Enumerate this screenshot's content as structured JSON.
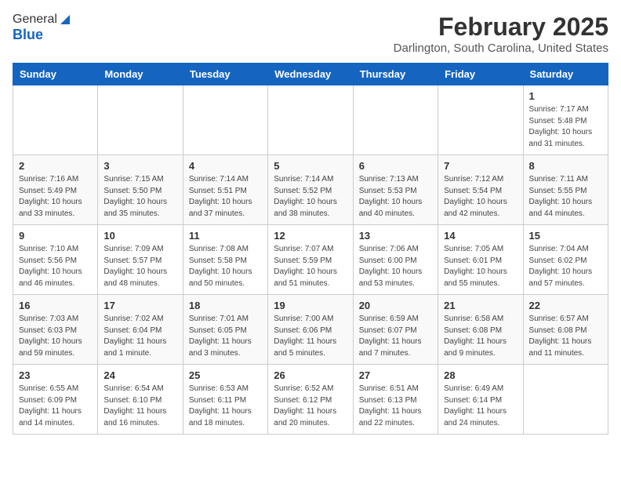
{
  "header": {
    "logo_general": "General",
    "logo_blue": "Blue",
    "title": "February 2025",
    "subtitle": "Darlington, South Carolina, United States"
  },
  "days_of_week": [
    "Sunday",
    "Monday",
    "Tuesday",
    "Wednesday",
    "Thursday",
    "Friday",
    "Saturday"
  ],
  "weeks": [
    [
      {
        "day": "",
        "info": ""
      },
      {
        "day": "",
        "info": ""
      },
      {
        "day": "",
        "info": ""
      },
      {
        "day": "",
        "info": ""
      },
      {
        "day": "",
        "info": ""
      },
      {
        "day": "",
        "info": ""
      },
      {
        "day": "1",
        "info": "Sunrise: 7:17 AM\nSunset: 5:48 PM\nDaylight: 10 hours and 31 minutes."
      }
    ],
    [
      {
        "day": "2",
        "info": "Sunrise: 7:16 AM\nSunset: 5:49 PM\nDaylight: 10 hours and 33 minutes."
      },
      {
        "day": "3",
        "info": "Sunrise: 7:15 AM\nSunset: 5:50 PM\nDaylight: 10 hours and 35 minutes."
      },
      {
        "day": "4",
        "info": "Sunrise: 7:14 AM\nSunset: 5:51 PM\nDaylight: 10 hours and 37 minutes."
      },
      {
        "day": "5",
        "info": "Sunrise: 7:14 AM\nSunset: 5:52 PM\nDaylight: 10 hours and 38 minutes."
      },
      {
        "day": "6",
        "info": "Sunrise: 7:13 AM\nSunset: 5:53 PM\nDaylight: 10 hours and 40 minutes."
      },
      {
        "day": "7",
        "info": "Sunrise: 7:12 AM\nSunset: 5:54 PM\nDaylight: 10 hours and 42 minutes."
      },
      {
        "day": "8",
        "info": "Sunrise: 7:11 AM\nSunset: 5:55 PM\nDaylight: 10 hours and 44 minutes."
      }
    ],
    [
      {
        "day": "9",
        "info": "Sunrise: 7:10 AM\nSunset: 5:56 PM\nDaylight: 10 hours and 46 minutes."
      },
      {
        "day": "10",
        "info": "Sunrise: 7:09 AM\nSunset: 5:57 PM\nDaylight: 10 hours and 48 minutes."
      },
      {
        "day": "11",
        "info": "Sunrise: 7:08 AM\nSunset: 5:58 PM\nDaylight: 10 hours and 50 minutes."
      },
      {
        "day": "12",
        "info": "Sunrise: 7:07 AM\nSunset: 5:59 PM\nDaylight: 10 hours and 51 minutes."
      },
      {
        "day": "13",
        "info": "Sunrise: 7:06 AM\nSunset: 6:00 PM\nDaylight: 10 hours and 53 minutes."
      },
      {
        "day": "14",
        "info": "Sunrise: 7:05 AM\nSunset: 6:01 PM\nDaylight: 10 hours and 55 minutes."
      },
      {
        "day": "15",
        "info": "Sunrise: 7:04 AM\nSunset: 6:02 PM\nDaylight: 10 hours and 57 minutes."
      }
    ],
    [
      {
        "day": "16",
        "info": "Sunrise: 7:03 AM\nSunset: 6:03 PM\nDaylight: 10 hours and 59 minutes."
      },
      {
        "day": "17",
        "info": "Sunrise: 7:02 AM\nSunset: 6:04 PM\nDaylight: 11 hours and 1 minute."
      },
      {
        "day": "18",
        "info": "Sunrise: 7:01 AM\nSunset: 6:05 PM\nDaylight: 11 hours and 3 minutes."
      },
      {
        "day": "19",
        "info": "Sunrise: 7:00 AM\nSunset: 6:06 PM\nDaylight: 11 hours and 5 minutes."
      },
      {
        "day": "20",
        "info": "Sunrise: 6:59 AM\nSunset: 6:07 PM\nDaylight: 11 hours and 7 minutes."
      },
      {
        "day": "21",
        "info": "Sunrise: 6:58 AM\nSunset: 6:08 PM\nDaylight: 11 hours and 9 minutes."
      },
      {
        "day": "22",
        "info": "Sunrise: 6:57 AM\nSunset: 6:08 PM\nDaylight: 11 hours and 11 minutes."
      }
    ],
    [
      {
        "day": "23",
        "info": "Sunrise: 6:55 AM\nSunset: 6:09 PM\nDaylight: 11 hours and 14 minutes."
      },
      {
        "day": "24",
        "info": "Sunrise: 6:54 AM\nSunset: 6:10 PM\nDaylight: 11 hours and 16 minutes."
      },
      {
        "day": "25",
        "info": "Sunrise: 6:53 AM\nSunset: 6:11 PM\nDaylight: 11 hours and 18 minutes."
      },
      {
        "day": "26",
        "info": "Sunrise: 6:52 AM\nSunset: 6:12 PM\nDaylight: 11 hours and 20 minutes."
      },
      {
        "day": "27",
        "info": "Sunrise: 6:51 AM\nSunset: 6:13 PM\nDaylight: 11 hours and 22 minutes."
      },
      {
        "day": "28",
        "info": "Sunrise: 6:49 AM\nSunset: 6:14 PM\nDaylight: 11 hours and 24 minutes."
      },
      {
        "day": "",
        "info": ""
      }
    ]
  ]
}
